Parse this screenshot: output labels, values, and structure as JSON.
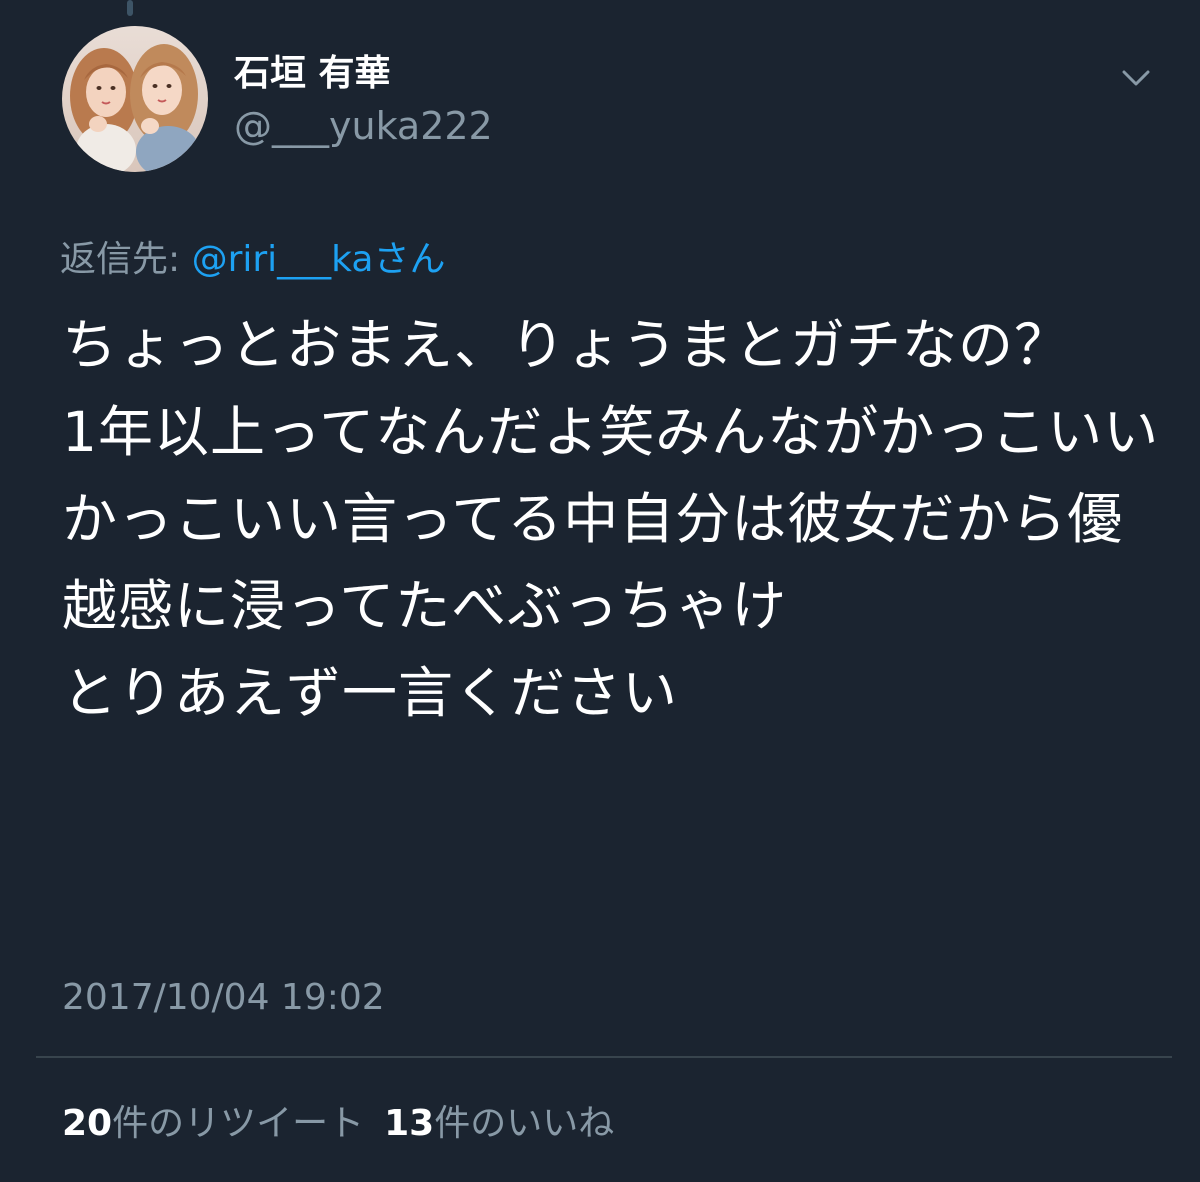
{
  "user": {
    "display_name": "石垣 有華",
    "handle": "@___yuka222",
    "avatar_icon": "avatar-photo"
  },
  "menu": {
    "icon": "chevron-down-icon"
  },
  "reply": {
    "prefix": "返信先: ",
    "mention": "@riri___ka",
    "suffix": "さん"
  },
  "tweet": {
    "text": "ちょっとおまえ、りょうまとガチなの？\n1年以上ってなんだよ笑みんながかっこいいかっこいい言ってる中自分は彼女だから優越感に浸ってたべぶっちゃけ\nとりあえず一言ください"
  },
  "timestamp": "2017/10/04 19:02",
  "stats": {
    "retweets_count": "20",
    "retweets_label": "件のリツイート",
    "likes_count": "13",
    "likes_label": "件のいいね"
  },
  "colors": {
    "background": "#1b2430",
    "text_primary": "#ffffff",
    "text_secondary": "#8899a6",
    "accent": "#1da1f2",
    "divider": "#38444d"
  }
}
